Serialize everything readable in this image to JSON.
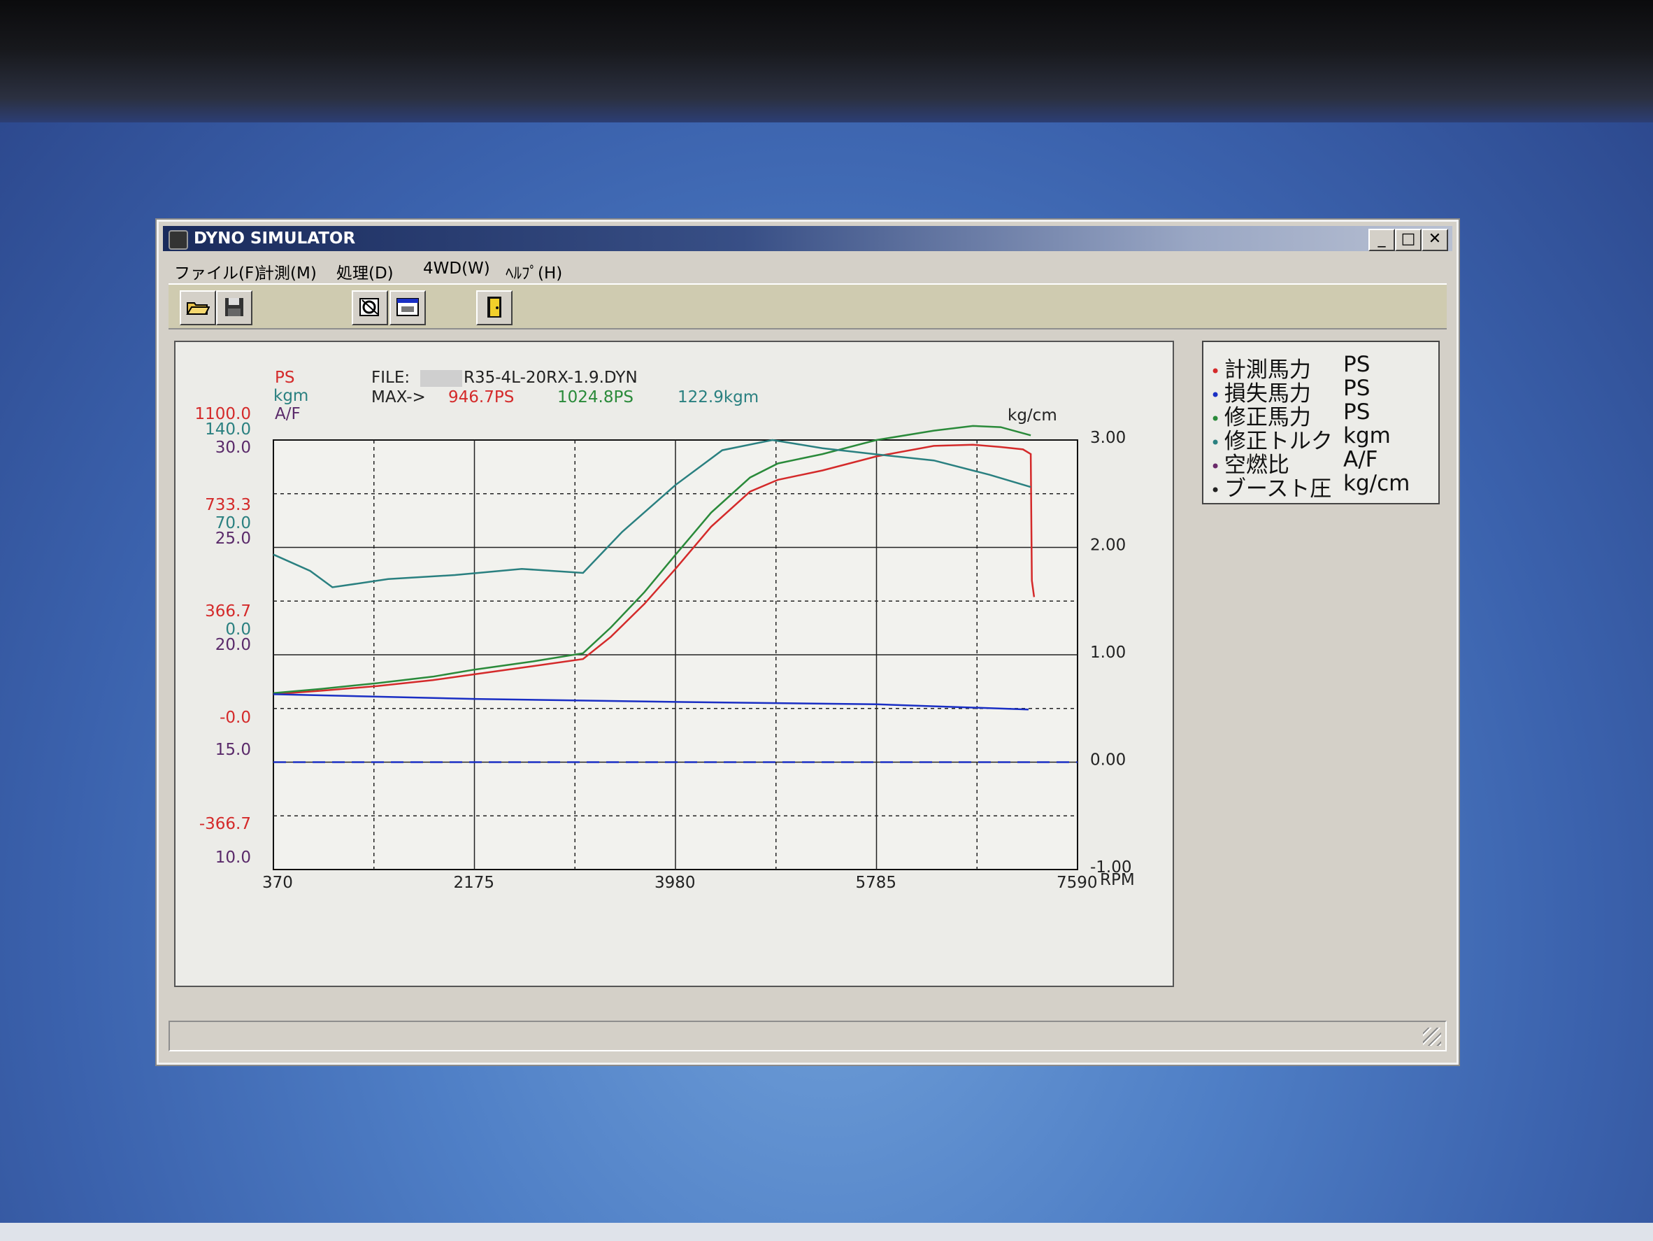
{
  "window": {
    "title": "DYNO SIMULATOR",
    "minimize": "_",
    "maximize": "□",
    "close": "✕"
  },
  "menu": [
    "ファイル(F)",
    "計測(M)",
    "処理(D)",
    "4WD(W)",
    "ﾍﾙﾌﾟ(H)"
  ],
  "toolbar": {
    "icons": [
      "open-folder-icon",
      "save-disk-icon",
      "process-icon",
      "display-icon",
      "exit-door-icon"
    ]
  },
  "chart_header": {
    "ps_unit": "PS",
    "kgm_unit": "kgm",
    "af_unit": "A/F",
    "file_label": "FILE:",
    "file_name": "R35-4L-20RX-1.9.DYN",
    "max_label": "MAX->",
    "max_ps": "946.7PS",
    "max_corrected_ps": "1024.8PS",
    "max_torque": "122.9kgm",
    "right_unit": "kg/cm",
    "x_unit": "RPM"
  },
  "legend": [
    {
      "label": "計測馬力",
      "unit": "PS",
      "color": "#d42a2a"
    },
    {
      "label": "損失馬力",
      "unit": "PS",
      "color": "#1a2fc4"
    },
    {
      "label": "修正馬力",
      "unit": "PS",
      "color": "#2a8a3a"
    },
    {
      "label": "修正トルク",
      "unit": "kgm",
      "color": "#2a8080"
    },
    {
      "label": "空燃比",
      "unit": "A/F",
      "color": "#6a2a6a"
    },
    {
      "label": "ブースト圧",
      "unit": "kg/cm",
      "color": "#222222"
    }
  ],
  "colors": {
    "ps": "#d42a2a",
    "kgm": "#2a8080",
    "af": "#5a2a6a",
    "loss": "#1a2fc4",
    "corrected": "#2a8a3a"
  },
  "chart_data": {
    "type": "line",
    "xlabel": "RPM",
    "xlim": [
      370,
      7590
    ],
    "x_ticks": [
      "370",
      "2175",
      "3980",
      "5785",
      "7590"
    ],
    "left_axis_ps": [
      "1100.0",
      "733.3",
      "366.7",
      "-0.0",
      "-366.7"
    ],
    "left_axis_kgm": [
      "140.0",
      "70.0",
      "0.0"
    ],
    "left_axis_af": [
      "30.0",
      "25.0",
      "20.0",
      "15.0",
      "10.0"
    ],
    "right_axis": [
      "3.00",
      "2.00",
      "1.00",
      "0.00",
      "-1.00"
    ],
    "ps_range": [
      -733.3,
      1100.0
    ],
    "series": [
      {
        "name": "計測馬力",
        "color": "#d42a2a",
        "x": [
          370,
          800,
          1300,
          1800,
          2175,
          2700,
          3150,
          3400,
          3700,
          3980,
          4300,
          4650,
          4900,
          5300,
          5785,
          6300,
          6650,
          6900,
          7100,
          7170,
          7180,
          7200
        ],
        "y": [
          15,
          30,
          50,
          75,
          100,
          135,
          165,
          260,
          400,
          550,
          730,
          880,
          930,
          970,
          1030,
          1075,
          1080,
          1070,
          1060,
          1040,
          500,
          430
        ]
      },
      {
        "name": "修正馬力",
        "color": "#2a8a3a",
        "x": [
          370,
          800,
          1300,
          1800,
          2175,
          2700,
          3150,
          3400,
          3700,
          3980,
          4300,
          4650,
          4900,
          5300,
          5785,
          6300,
          6650,
          6900,
          7170
        ],
        "y": [
          20,
          38,
          62,
          90,
          120,
          155,
          190,
          300,
          450,
          610,
          790,
          940,
          1000,
          1040,
          1100,
          1140,
          1160,
          1155,
          1120
        ]
      },
      {
        "name": "修正トルク",
        "color": "#2a8080",
        "x": [
          370,
          700,
          900,
          1400,
          2000,
          2600,
          3150,
          3500,
          3980,
          4400,
          4850,
          5300,
          5785,
          6300,
          6800,
          7170
        ],
        "y": [
          84,
          76,
          68,
          72,
          74,
          77,
          75,
          95,
          118,
          135,
          140,
          136,
          133,
          130,
          123,
          117
        ]
      },
      {
        "name": "損失馬力",
        "color": "#1a2fc4",
        "x": [
          370,
          2175,
          3980,
          5785,
          7150
        ],
        "y": [
          15,
          -5,
          -18,
          -28,
          -50
        ]
      },
      {
        "name": "ブースト圧",
        "color": "#1a2fc4",
        "x": [
          370,
          7590
        ],
        "y": [
          0.0,
          0.0
        ]
      }
    ]
  }
}
